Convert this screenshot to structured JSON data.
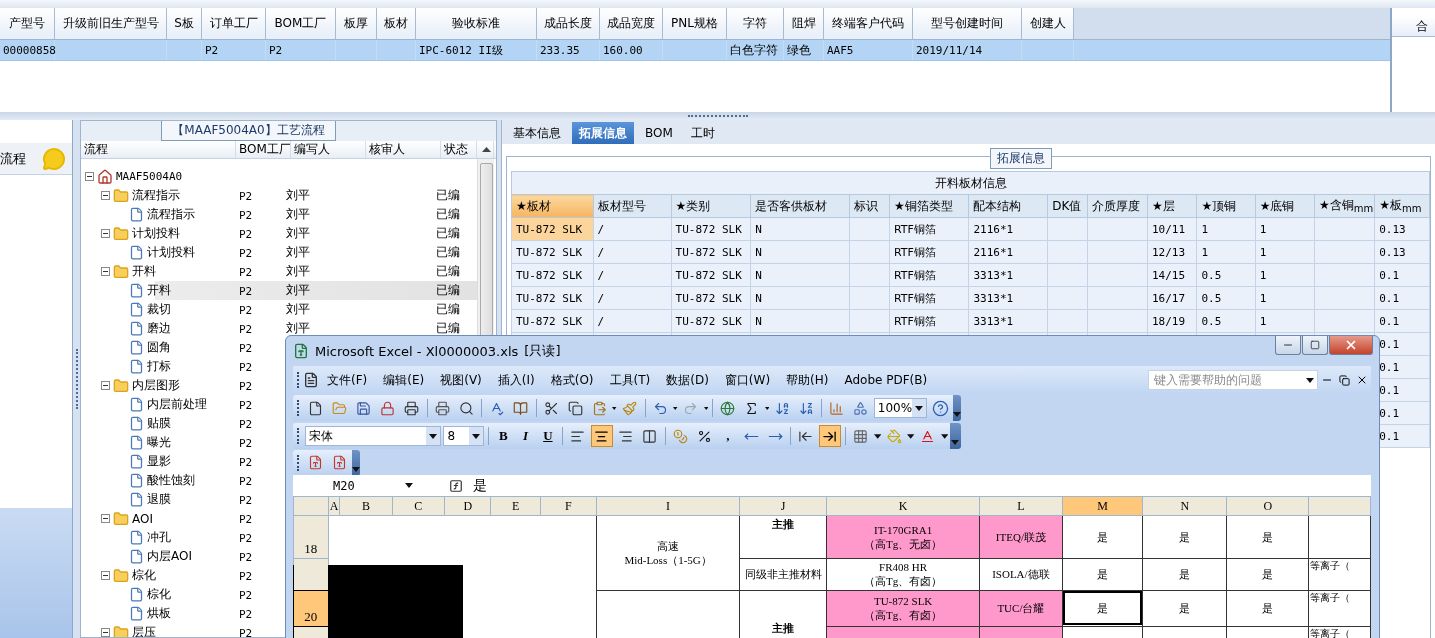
{
  "top_grid": {
    "columns": [
      "产型号",
      "升级前旧生产型号",
      "S板",
      "订单工厂",
      "BOM工厂",
      "板厚",
      "板材",
      "验收标准",
      "成品长度",
      "成品宽度",
      "PNL规格",
      "字符",
      "阻焊",
      "终端客户代码",
      "型号创建时间",
      "创建人"
    ],
    "rows": [
      {
        "selected": true,
        "cells": [
          "00000858",
          null,
          null,
          "P2",
          "P2",
          null,
          null,
          "IPC-6012 II级",
          "233.35",
          "160.00",
          null,
          "白色字符",
          "绿色",
          "AAF5",
          "2019/11/14",
          null
        ]
      }
    ],
    "side_header": "合"
  },
  "left_panel": {
    "title": "流程"
  },
  "process_panel": {
    "title": "【MAAF5004A0】工艺流程",
    "columns": [
      "流程",
      "BOM工厂",
      "编写人",
      "核审人",
      "状态"
    ],
    "tree": [
      {
        "label": "MAAF5004A0",
        "kind": "root",
        "expanded": true,
        "selected": false,
        "children": [
          {
            "label": "流程指示",
            "kind": "folder",
            "bom": "P2",
            "writer": "刘平",
            "status": "已编",
            "expanded": true,
            "selected": false,
            "children": [
              {
                "label": "流程指示",
                "kind": "step",
                "bom": "P2",
                "writer": "刘平",
                "status": "已编",
                "selected": false
              }
            ]
          },
          {
            "label": "计划投料",
            "kind": "folder",
            "bom": "P2",
            "writer": "刘平",
            "status": "已编",
            "expanded": true,
            "selected": false,
            "children": [
              {
                "label": "计划投料",
                "kind": "step",
                "bom": "P2",
                "writer": "刘平",
                "status": "已编",
                "selected": false
              }
            ]
          },
          {
            "label": "开料",
            "kind": "folder",
            "bom": "P2",
            "writer": "刘平",
            "status": "已编",
            "expanded": true,
            "selected": false,
            "children": [
              {
                "label": "开料",
                "kind": "step",
                "bom": "P2",
                "writer": "刘平",
                "status": "已编",
                "selected": true
              },
              {
                "label": "裁切",
                "kind": "step",
                "bom": "P2",
                "writer": "刘平",
                "status": "已编",
                "selected": false
              },
              {
                "label": "磨边",
                "kind": "step",
                "bom": "P2",
                "writer": "刘平",
                "status": "已编",
                "selected": false
              },
              {
                "label": "圆角",
                "kind": "step",
                "bom": "P2",
                "selected": false
              },
              {
                "label": "打标",
                "kind": "step",
                "bom": "P2",
                "selected": false
              }
            ]
          },
          {
            "label": "内层图形",
            "kind": "folder",
            "bom": "P2",
            "expanded": true,
            "selected": false,
            "children": [
              {
                "label": "内层前处理",
                "kind": "step",
                "bom": "P2",
                "selected": false
              },
              {
                "label": "贴膜",
                "kind": "step",
                "bom": "P2",
                "selected": false
              },
              {
                "label": "曝光",
                "kind": "step",
                "bom": "P2",
                "selected": false
              },
              {
                "label": "显影",
                "kind": "step",
                "bom": "P2",
                "selected": false
              },
              {
                "label": "酸性蚀刻",
                "kind": "step",
                "bom": "P2",
                "selected": false
              },
              {
                "label": "退膜",
                "kind": "step",
                "bom": "P2",
                "selected": false
              }
            ]
          },
          {
            "label": "AOI",
            "kind": "folder",
            "bom": "P2",
            "expanded": true,
            "selected": false,
            "children": [
              {
                "label": "冲孔",
                "kind": "step",
                "bom": "P2",
                "selected": false
              },
              {
                "label": "内层AOI",
                "kind": "step",
                "bom": "P2",
                "selected": false
              }
            ]
          },
          {
            "label": "棕化",
            "kind": "folder",
            "bom": "P2",
            "expanded": true,
            "selected": false,
            "children": [
              {
                "label": "棕化",
                "kind": "step",
                "bom": "P2",
                "selected": false
              },
              {
                "label": "烘板",
                "kind": "step",
                "bom": "P2",
                "selected": false
              }
            ]
          },
          {
            "label": "层压",
            "kind": "folder",
            "bom": "P2",
            "expanded": true,
            "selected": false
          }
        ]
      }
    ]
  },
  "detail_tabs": [
    {
      "label": "基本信息",
      "selected": false
    },
    {
      "label": "拓展信息",
      "selected": true
    },
    {
      "label": "BOM",
      "selected": false
    },
    {
      "label": "工时",
      "selected": false
    }
  ],
  "group_title": "拓展信息",
  "material_table": {
    "title": "开料板材信息",
    "columns": [
      {
        "label": "★板材",
        "selected": true
      },
      {
        "label": "板材型号",
        "selected": false
      },
      {
        "label": "★类别",
        "selected": false
      },
      {
        "label": "是否客供板材",
        "selected": false
      },
      {
        "label": "标识",
        "selected": false
      },
      {
        "label": "★铜箔类型",
        "selected": false
      },
      {
        "label": "配本结构",
        "selected": false
      },
      {
        "label": "DK值",
        "selected": false
      },
      {
        "label": "介质厚度",
        "selected": false
      },
      {
        "label": "★层",
        "selected": false
      },
      {
        "label": "★顶铜",
        "selected": false
      },
      {
        "label": "★底铜",
        "selected": false
      },
      {
        "label": "★含铜$_{mm}$",
        "selected": false
      },
      {
        "label": "★板$_{mm}$",
        "selected": false
      }
    ],
    "rows": [
      {
        "selected": true,
        "cells": [
          "TU-872 SLK",
          "/",
          "TU-872 SLK",
          "N",
          null,
          "RTF铜箔",
          "2116*1",
          null,
          null,
          "10/11",
          "1",
          "1",
          null,
          "0.13"
        ]
      },
      {
        "selected": false,
        "cells": [
          "TU-872 SLK",
          "/",
          "TU-872 SLK",
          "N",
          null,
          "RTF铜箔",
          "2116*1",
          null,
          null,
          "12/13",
          "1",
          "1",
          null,
          "0.13"
        ]
      },
      {
        "selected": false,
        "cells": [
          "TU-872 SLK",
          "/",
          "TU-872 SLK",
          "N",
          null,
          "RTF铜箔",
          "3313*1",
          null,
          null,
          "14/15",
          "0.5",
          "1",
          null,
          "0.1"
        ]
      },
      {
        "selected": false,
        "cells": [
          "TU-872 SLK",
          "/",
          "TU-872 SLK",
          "N",
          null,
          "RTF铜箔",
          "3313*1",
          null,
          null,
          "16/17",
          "0.5",
          "1",
          null,
          "0.1"
        ]
      },
      {
        "selected": false,
        "cells": [
          "TU-872 SLK",
          "/",
          "TU-872 SLK",
          "N",
          null,
          "RTF铜箔",
          "3313*1",
          null,
          null,
          "18/19",
          "0.5",
          "1",
          null,
          "0.1"
        ]
      },
      {
        "cells": [
          null,
          null,
          null,
          null,
          null,
          null,
          null,
          null,
          null,
          null,
          null,
          null,
          null,
          "0.1"
        ]
      },
      {
        "cells": [
          null,
          null,
          null,
          null,
          null,
          null,
          null,
          null,
          null,
          null,
          null,
          null,
          null,
          "0.1"
        ]
      },
      {
        "cells": [
          null,
          null,
          null,
          null,
          null,
          null,
          null,
          null,
          null,
          null,
          null,
          null,
          null,
          "0.1"
        ]
      },
      {
        "cells": [
          null,
          null,
          null,
          null,
          null,
          null,
          null,
          null,
          null,
          null,
          null,
          null,
          null,
          "0.1"
        ]
      },
      {
        "cells": [
          null,
          null,
          null,
          null,
          null,
          null,
          null,
          null,
          null,
          null,
          null,
          null,
          null,
          "0.1"
        ]
      }
    ]
  },
  "excel": {
    "title": "Microsoft Excel - Xl0000003.xls",
    "readonly": "[只读]",
    "menu": [
      "文件(F)",
      "编辑(E)",
      "视图(V)",
      "插入(I)",
      "格式(O)",
      "工具(T)",
      "数据(D)",
      "窗口(W)",
      "帮助(H)",
      "Adobe PDF(B)"
    ],
    "help_placeholder": "键入需要帮助的问题",
    "zoom": "100%",
    "font": "宋体",
    "font_size": "8",
    "style_buttons": [
      "B",
      "I",
      "U"
    ],
    "comma_button": ",",
    "name_box": "M20",
    "formula": "是",
    "columns": [
      {
        "label": "A",
        "selected": false
      },
      {
        "label": "B",
        "selected": false
      },
      {
        "label": "C",
        "selected": false
      },
      {
        "label": "D",
        "selected": false
      },
      {
        "label": "E",
        "selected": false
      },
      {
        "label": "F",
        "selected": false
      },
      {
        "label": "I",
        "selected": false
      },
      {
        "label": "J",
        "selected": false
      },
      {
        "label": "K",
        "selected": false
      },
      {
        "label": "L",
        "selected": false
      },
      {
        "label": "M",
        "selected": true
      },
      {
        "label": "N",
        "selected": false
      },
      {
        "label": "O",
        "selected": false
      }
    ],
    "row_numbers": [
      {
        "label": "18",
        "selected": false
      },
      {
        "label": "20",
        "selected": true
      }
    ],
    "speed_class": "高速\nMid-Loss（1-5G）",
    "grade_merged": "主推",
    "rows": [
      {
        "grade": "主推",
        "material": "IT-170GRA1\n（高Tg、无卤）",
        "highlight": true,
        "supplier": "ITEQ/联茂",
        "flags": [
          {
            "label": "是",
            "selected": false
          },
          {
            "label": "是",
            "selected": false
          },
          {
            "label": "是",
            "selected": false
          }
        ]
      },
      {
        "grade": "同级非主推材料",
        "material": "FR408 HR\n（高Tg、有卤）",
        "highlight": false,
        "supplier": "ISOLA/德联",
        "flags": [
          {
            "label": "是",
            "selected": false
          },
          {
            "label": "是",
            "selected": false
          },
          {
            "label": "是",
            "selected": false
          }
        ],
        "note": "等离子（"
      },
      {
        "material": "TU-872 SLK\n（高Tg、有卤）",
        "highlight": true,
        "supplier": "TUC/台耀",
        "flags": [
          {
            "label": "是",
            "selected": true
          },
          {
            "label": "是",
            "selected": false
          },
          {
            "label": "是",
            "selected": false
          }
        ],
        "note": "等离子（"
      },
      {
        "highlight": true,
        "note": "等离子（"
      }
    ]
  }
}
